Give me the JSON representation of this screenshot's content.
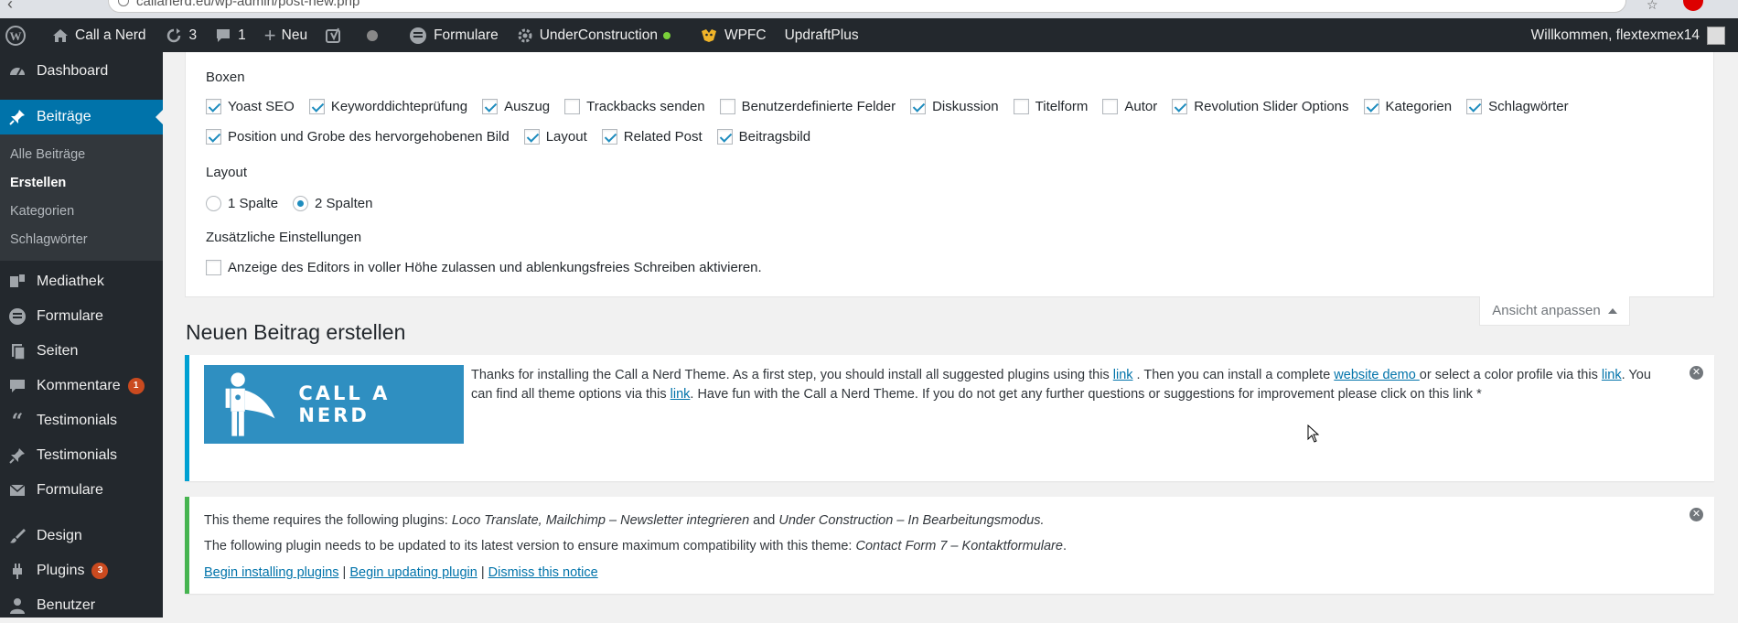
{
  "browser": {
    "url": "callanerd.eu/wp-admin/post-new.php"
  },
  "adminbar": {
    "site_name": "Call a Nerd",
    "updates_count": "3",
    "comments_count": "1",
    "new_label": "Neu",
    "formulare": "Formulare",
    "under_construction": "UnderConstruction",
    "wpfc": "WPFC",
    "updraft": "UpdraftPlus",
    "greeting": "Willkommen, flextexmex14"
  },
  "sidebar": {
    "dashboard": "Dashboard",
    "beitraege": "Beiträge",
    "sub": [
      "Alle Beiträge",
      "Erstellen",
      "Kategorien",
      "Schlagwörter"
    ],
    "mediathek": "Mediathek",
    "formulare1": "Formulare",
    "seiten": "Seiten",
    "kommentare": "Kommentare",
    "kommentare_badge": "1",
    "testimonials1": "Testimonials",
    "testimonials2": "Testimonials",
    "formulare2": "Formulare",
    "design": "Design",
    "plugins": "Plugins",
    "plugins_badge": "3",
    "benutzer": "Benutzer"
  },
  "screen_options": {
    "boxen_title": "Boxen",
    "boxes_row1": [
      "Yoast SEO",
      "Keyworddichteprüfung",
      "Auszug",
      "Trackbacks senden",
      "Benutzerdefinierte Felder",
      "Diskussion",
      "Titelform",
      "Autor",
      "Revolution Slider Options",
      "Kategorien",
      "Schlagwörter"
    ],
    "boxes_row2": [
      "Position und Grobe des hervorgehobenen Bild",
      "Layout",
      "Related Post",
      "Beitragsbild"
    ],
    "layout_title": "Layout",
    "layout_options": [
      "1 Spalte",
      "2 Spalten"
    ],
    "extra_title": "Zusätzliche Einstellungen",
    "extra_option": "Anzeige des Editors in voller Höhe zulassen und ablenkungsfreies Schreiben aktivieren.",
    "toggle_label": "Ansicht anpassen"
  },
  "page": {
    "title": "Neuen Beitrag erstellen"
  },
  "notice1": {
    "banner": "CALL A NERD",
    "t1": "Thanks for installing the Call a Nerd Theme. As a first step, you should install all suggested plugins using this ",
    "link1": "link",
    "t2": " . Then you can install a complete ",
    "link2": "website demo ",
    "t3": "or select a color profile via this ",
    "link3": "link",
    "t4": ". You can find all theme options via this ",
    "link4": "link",
    "t5": ". Have fun with the Call a Nerd Theme. If you do not get any further questions or suggestions for improvement please click on this link *"
  },
  "notice2": {
    "l1a": "This theme requires the following plugins: ",
    "l1b": "Loco Translate",
    "l1c": ", ",
    "l1d": "Mailchimp – Newsletter integrieren",
    "l1e": " and ",
    "l1f": "Under Construction – In Bearbeitungsmodus",
    "l1g": ".",
    "l2a": "The following plugin needs to be updated to its latest version to ensure maximum compatibility with this theme: ",
    "l2b": "Contact Form 7 – Kontaktformulare",
    "l2c": ".",
    "action1": "Begin installing plugins",
    "action2": "Begin updating plugin",
    "action3": "Dismiss this notice",
    "sep": " | "
  },
  "colors": {
    "adminbar": "#23282d",
    "accent": "#0073aa",
    "banner": "#2f8fc1",
    "success": "#46b450"
  }
}
